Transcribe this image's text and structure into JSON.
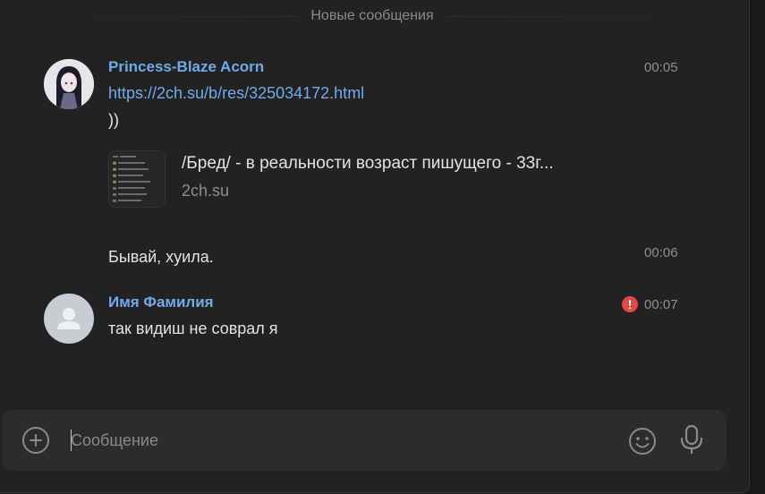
{
  "divider": {
    "label": "Новые сообщения"
  },
  "messages": [
    {
      "author": "Princess-Blaze Acorn",
      "time": "00:05",
      "link": "https://2ch.su/b/res/325034172.html",
      "text": "))",
      "snippet": {
        "title": "/Бред/ - в реальности возраст пишущего - 33г...",
        "domain": "2ch.su"
      }
    },
    {
      "text": "Бывай, хуила.",
      "time": "00:06"
    },
    {
      "author": "Имя Фамилия",
      "time": "00:07",
      "text": "так видиш не соврал я",
      "status": "error"
    }
  ],
  "composer": {
    "placeholder": "Сообщение",
    "value": ""
  },
  "icons": {
    "attach": "plus-circle-icon",
    "emoji": "smile-icon",
    "voice": "microphone-icon",
    "error": "exclamation-circle-icon"
  },
  "colors": {
    "accent": "#71aaeb",
    "error": "#e64646",
    "background": "#222222"
  }
}
